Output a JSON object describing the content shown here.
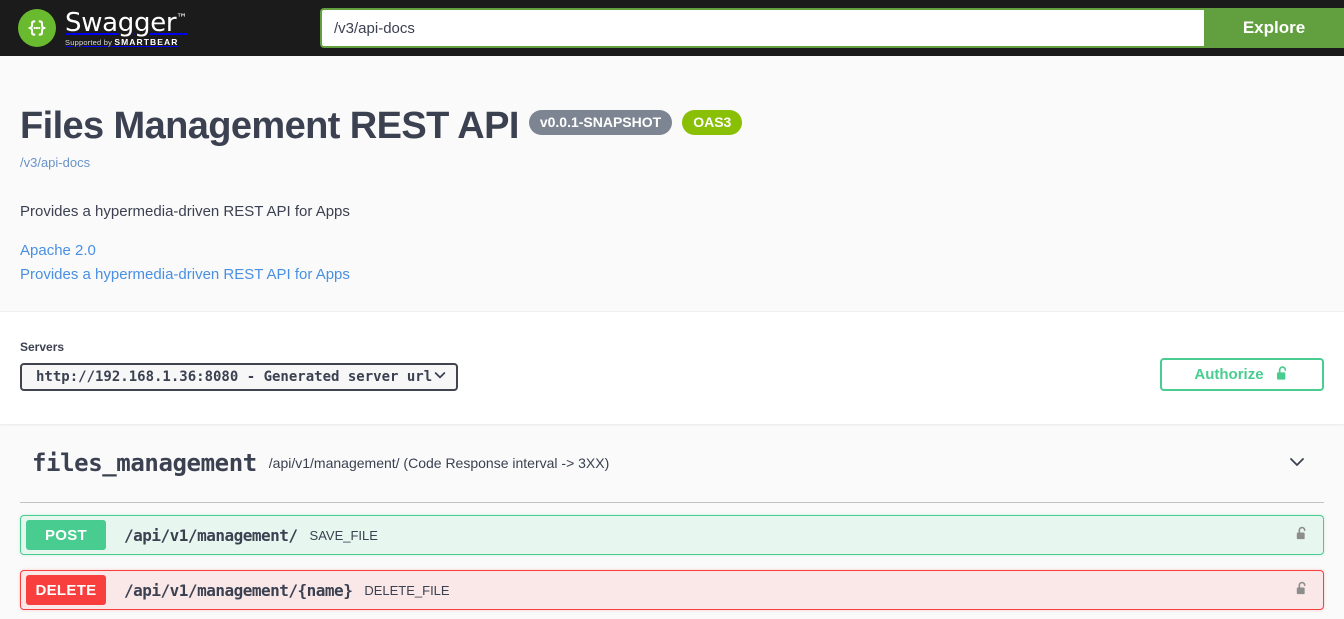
{
  "topbar": {
    "logo_word": "Swagger",
    "logo_trademark": "™",
    "logo_supported_by": "Supported by",
    "logo_brand": "SMARTBEAR",
    "logo_icon": "swagger-braces-icon",
    "url_value": "/v3/api-docs",
    "url_placeholder": "/v3/api-docs",
    "explore_label": "Explore"
  },
  "info": {
    "title": "Files Management REST API",
    "version_badge": "v0.0.1-SNAPSHOT",
    "oas_badge": "OAS3",
    "spec_url": "/v3/api-docs",
    "description": "Provides a hypermedia-driven REST API for Apps",
    "license_link": "Apache 2.0",
    "terms_link": "Provides a hypermedia-driven REST API for Apps"
  },
  "scheme": {
    "servers_label": "Servers",
    "selected_server": "http://192.168.1.36:8080 - Generated server url",
    "server_options": [
      "http://192.168.1.36:8080 - Generated server url"
    ],
    "chevron_icon": "chevron-down-icon",
    "authorize_label": "Authorize",
    "authorize_icon": "unlocked-padlock-icon"
  },
  "tag": {
    "name": "files_management",
    "description": "/api/v1/management/ (Code Response interval -> 3XX)",
    "toggle_icon": "chevron-down-icon"
  },
  "operations": [
    {
      "method": "POST",
      "path": "/api/v1/management/",
      "summary": "SAVE_FILE",
      "lock_icon": "unlocked-padlock-icon"
    },
    {
      "method": "DELETE",
      "path": "/api/v1/management/{name}",
      "summary": "DELETE_FILE",
      "lock_icon": "unlocked-padlock-icon"
    }
  ],
  "colors": {
    "topbar_bg": "#1b1b1b",
    "explore_green": "#62a03f",
    "logo_green": "#6aba2f",
    "oas_green": "#89bf04",
    "version_gray": "#7d8492",
    "authorize_green": "#49cc90",
    "post_green": "#49cc90",
    "delete_red": "#f93e3e",
    "link_blue": "#4990e2",
    "text": "#3b4151"
  }
}
